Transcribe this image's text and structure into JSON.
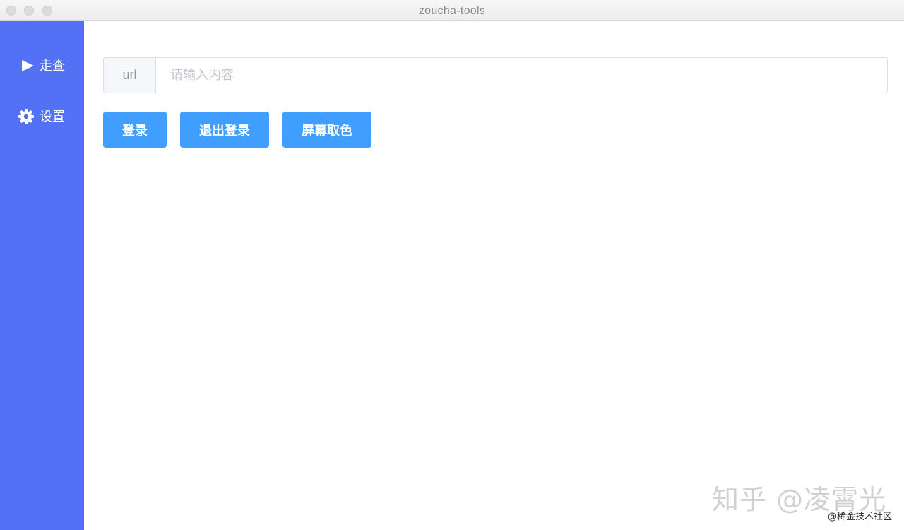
{
  "window": {
    "title": "zoucha-tools"
  },
  "sidebar": {
    "background": "#5271f5",
    "items": [
      {
        "label": "走查",
        "icon": "play-icon"
      },
      {
        "label": "设置",
        "icon": "gear-icon"
      }
    ]
  },
  "main": {
    "url_field": {
      "prefix": "url",
      "placeholder": "请输入内容",
      "value": ""
    },
    "buttons": [
      {
        "label": "登录"
      },
      {
        "label": "退出登录"
      },
      {
        "label": "屏幕取色"
      }
    ],
    "button_color": "#409eff"
  },
  "watermark": {
    "text": "知乎 @凌霄光",
    "sub": "@稀金技术社区"
  }
}
